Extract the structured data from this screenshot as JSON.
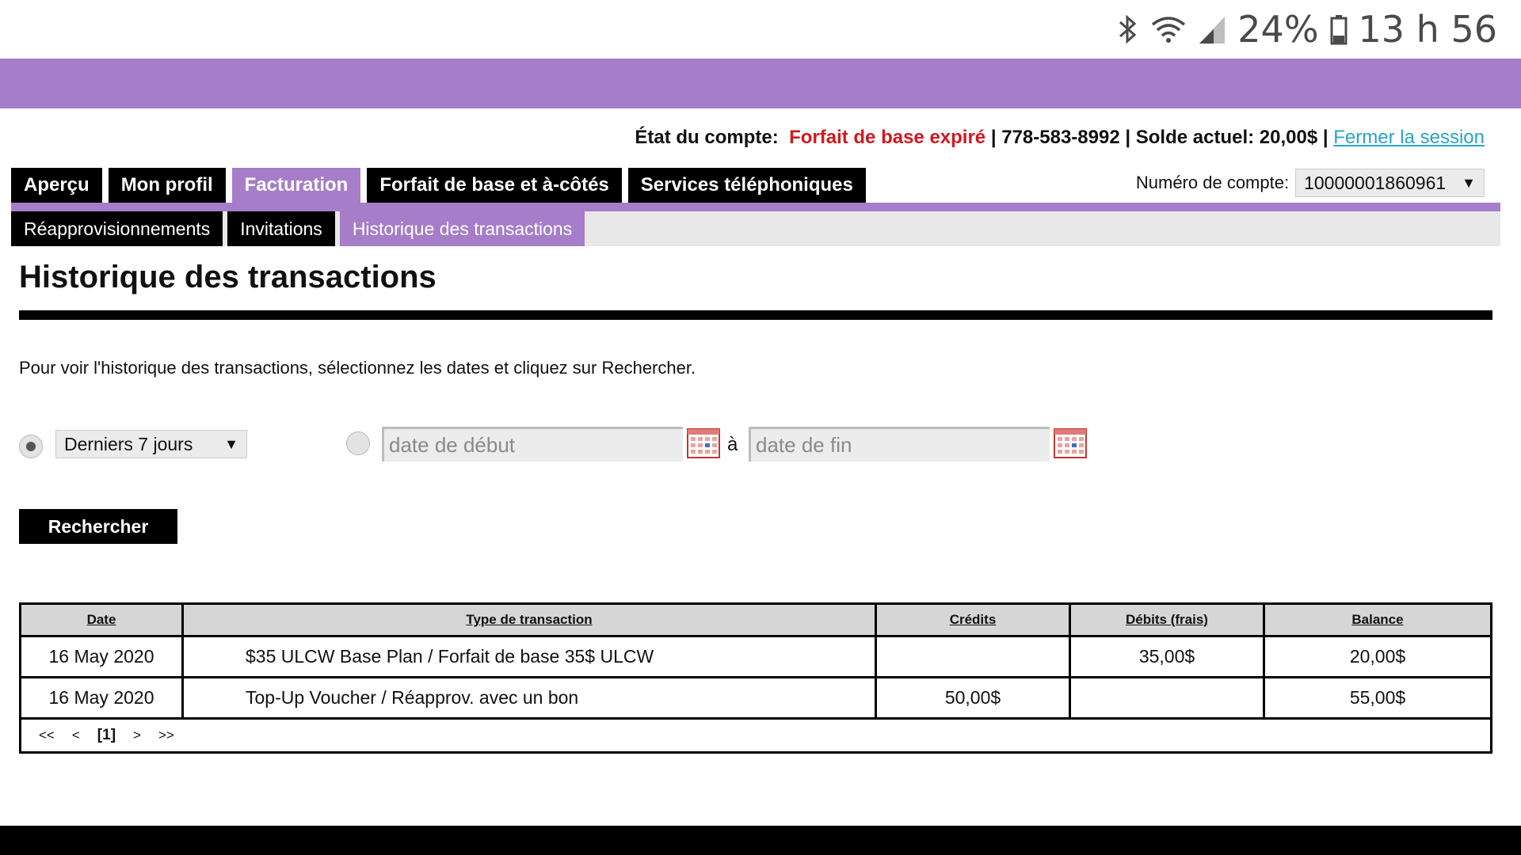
{
  "status_bar": {
    "battery": "24%",
    "time": "13 h 56"
  },
  "account_line": {
    "status_label": "État du compte:",
    "status_value": "Forfait de base expiré",
    "phone": "778-583-8992",
    "balance": "Solde actuel: 20,00$",
    "logout": "Fermer la session"
  },
  "tabs_main": [
    "Aperçu",
    "Mon profil",
    "Facturation",
    "Forfait de base et à-côtés",
    "Services téléphoniques"
  ],
  "tabs_main_active": "Facturation",
  "account_number": {
    "label": "Numéro de compte:",
    "value": "10000001860961"
  },
  "tabs_sub": [
    "Réapprovisionnements",
    "Invitations",
    "Historique des transactions"
  ],
  "tabs_sub_active": "Historique des transactions",
  "page": {
    "title": "Historique des transactions",
    "instructions": "Pour voir l'historique des transactions, sélectionnez les dates et cliquez sur Rechercher."
  },
  "filters": {
    "range_selected": "Derniers 7 jours",
    "start_placeholder": "date de début",
    "to_label": "à",
    "end_placeholder": "date de fin",
    "search_button": "Rechercher"
  },
  "table": {
    "headers": {
      "date": "Date",
      "type": "Type de transaction",
      "credits": "Crédits",
      "debits": "Débits (frais)",
      "balance": "Balance"
    },
    "rows": [
      {
        "date": "16 May 2020",
        "type": "$35 ULCW Base Plan / Forfait de base 35$ ULCW",
        "credits": "",
        "debits": "35,00$",
        "balance": "20,00$"
      },
      {
        "date": "16 May 2020",
        "type": "Top-Up Voucher / Réapprov. avec un bon",
        "credits": "50,00$",
        "debits": "",
        "balance": "55,00$"
      }
    ],
    "pager": {
      "first": "<<",
      "prev": "<",
      "current": "[1]",
      "next": ">",
      "last": ">>"
    }
  },
  "colors": {
    "purple": "#a67dc9",
    "status_red": "#d1181f",
    "link": "#2aa3c2"
  }
}
